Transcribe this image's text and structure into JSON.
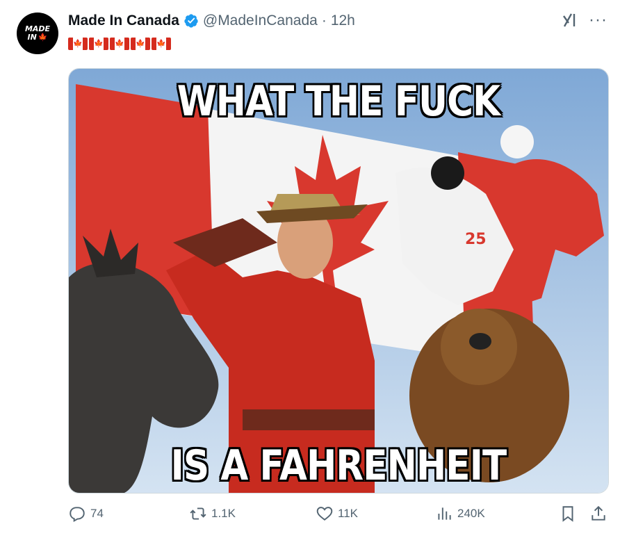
{
  "author": {
    "avatar_text_line1": "MADE",
    "avatar_text_line2": "IN",
    "display_name": "Made In Canada",
    "handle": "@MadeInCanada",
    "separator": "·",
    "timestamp": "12h",
    "flag_count": 5
  },
  "media": {
    "top_caption": "WHAT THE FUCK",
    "bottom_caption": "IS A FAHRENHEIT",
    "jersey_number": "25"
  },
  "actions": {
    "replies": "74",
    "reposts": "1.1K",
    "likes": "11K",
    "views": "240K"
  },
  "colors": {
    "verified_blue": "#1d9bf0",
    "text_secondary": "#536471",
    "canada_red": "#d52b1e"
  },
  "icons": [
    "verified-badge-icon",
    "grok-icon",
    "more-icon",
    "reply-icon",
    "repost-icon",
    "like-icon",
    "views-icon",
    "bookmark-icon",
    "share-icon"
  ]
}
